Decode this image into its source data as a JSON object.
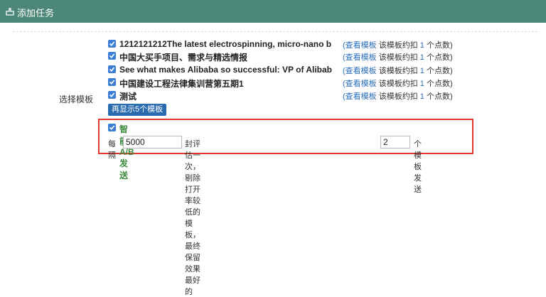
{
  "header": {
    "title": "添加任务",
    "icon": "hand-pointer-icon"
  },
  "templates": [
    {
      "title": "1212121212The latest electrospinning, micro-nano b",
      "view": "(查看模板",
      "note_pre": "该模板约扣",
      "num": "1",
      "note_post": "个点数)"
    },
    {
      "title": "中国大买手项目、需求与精选情报",
      "view": "(查看模板",
      "note_pre": "该模板约扣",
      "num": "1",
      "note_post": "个点数)"
    },
    {
      "title": "See what makes Alibaba so successful: VP of Alibab",
      "view": "(查看模板",
      "note_pre": "该模板约扣",
      "num": "1",
      "note_post": "个点数)"
    },
    {
      "title": "中国建设工程法律集训营第五期1",
      "view": "(查看模板",
      "note_pre": "该模板约扣",
      "num": "1",
      "note_post": "个点数)"
    },
    {
      "title": "测试",
      "view": "(查看模板",
      "note_pre": "该模板约扣",
      "num": "1",
      "note_post": "个点数)"
    }
  ],
  "side_label": "选择模板",
  "show_button": "再显示5个模板",
  "smart": {
    "label": "智能A/B发送",
    "every": "每隔",
    "interval_value": "5000",
    "mid_text": "封评估一次， 剔除打开率较低的模板， 最终保留效果最好的",
    "keep_value": "2",
    "tail_text": "个模板发送"
  },
  "colors": {
    "header_bg": "#4d8777",
    "link": "#2a6ebb",
    "checkbox": "#3a7fd5",
    "highlight_border": "#e0362b",
    "smart_label": "#3d8a3d"
  }
}
